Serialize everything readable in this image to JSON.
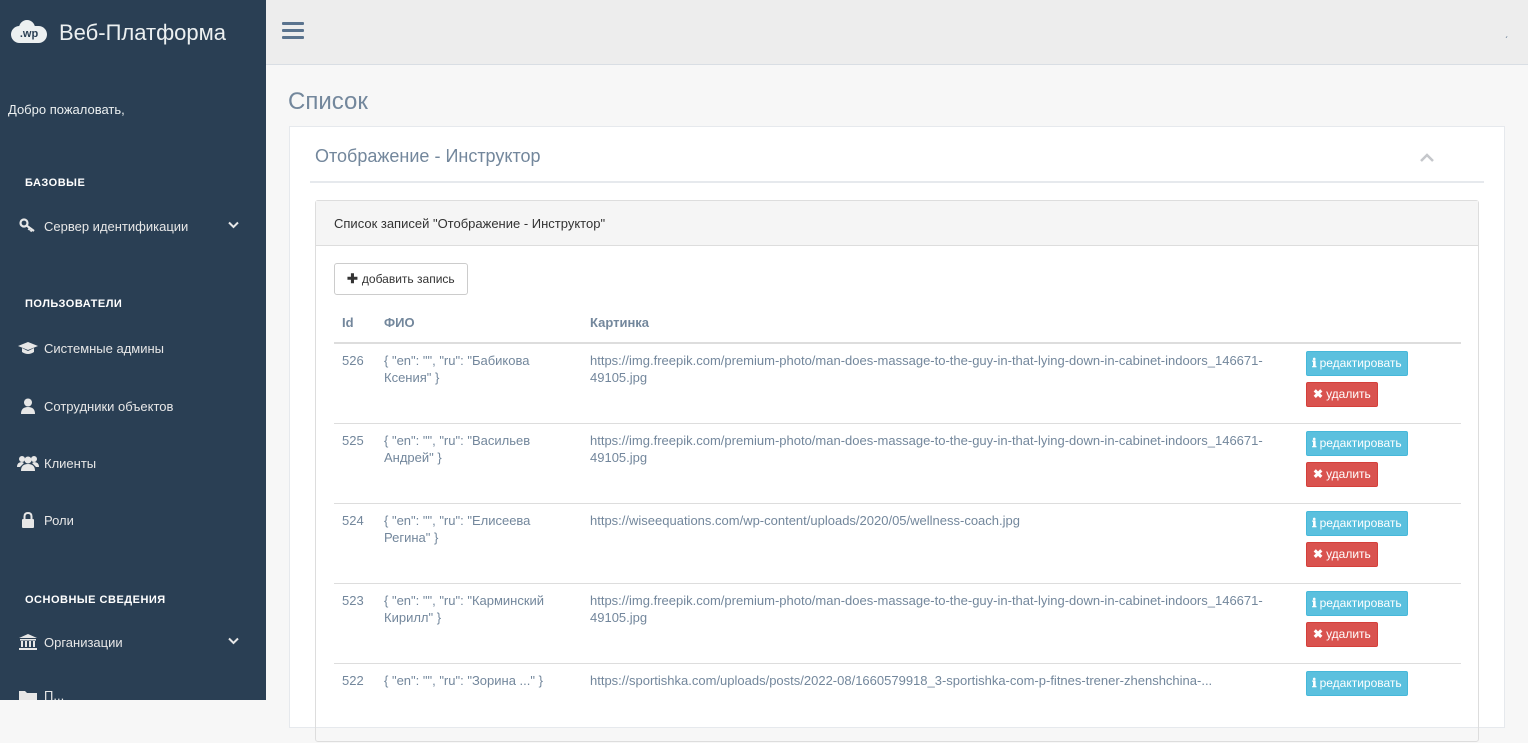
{
  "brand": {
    "logo_text": ".wp",
    "title": "Веб-Платформа"
  },
  "sidebar": {
    "welcome": "Добро пожаловать,",
    "sections": [
      {
        "title": "БАЗОВЫЕ"
      },
      {
        "title": "ПОЛЬЗОВАТЕЛИ"
      },
      {
        "title": "ОСНОВНЫЕ СВЕДЕНИЯ"
      }
    ],
    "items": [
      {
        "label": "Сервер идентификации",
        "icon": "key-icon"
      },
      {
        "label": "Системные админы",
        "icon": "graduation-cap-icon"
      },
      {
        "label": "Сотрудники объектов",
        "icon": "user-icon"
      },
      {
        "label": "Клиенты",
        "icon": "users-icon"
      },
      {
        "label": "Роли",
        "icon": "lock-icon"
      },
      {
        "label": "Организации",
        "icon": "bank-icon"
      },
      {
        "label": "П...",
        "icon": "folder-icon"
      }
    ]
  },
  "page": {
    "title": "Список"
  },
  "panel": {
    "title": "Отображение - Инструктор",
    "list_title": "Список записей \"Отображение - Инструктор\"",
    "add_label": "добавить запись",
    "columns": {
      "id": "Id",
      "fio": "ФИО",
      "picture": "Картинка"
    },
    "edit_label": "редактировать",
    "delete_label": "удалить",
    "rows": [
      {
        "id": "526",
        "fio": "{ \"en\": \"\", \"ru\": \"Бабикова Ксения\" }",
        "picture": "https://img.freepik.com/premium-photo/man-does-massage-to-the-guy-in-that-lying-down-in-cabinet-indoors_146671-49105.jpg"
      },
      {
        "id": "525",
        "fio": "{ \"en\": \"\", \"ru\": \"Васильев Андрей\" }",
        "picture": "https://img.freepik.com/premium-photo/man-does-massage-to-the-guy-in-that-lying-down-in-cabinet-indoors_146671-49105.jpg"
      },
      {
        "id": "524",
        "fio": "{ \"en\": \"\", \"ru\": \"Елисеева Регина\" }",
        "picture": "https://wiseequations.com/wp-content/uploads/2020/05/wellness-coach.jpg"
      },
      {
        "id": "523",
        "fio": "{ \"en\": \"\", \"ru\": \"Карминский Кирилл\" }",
        "picture": "https://img.freepik.com/premium-photo/man-does-massage-to-the-guy-in-that-lying-down-in-cabinet-indoors_146671-49105.jpg"
      },
      {
        "id": "522",
        "fio": "{ \"en\": \"\", \"ru\": \"Зорина ...\" }",
        "picture": "https://sportishka.com/uploads/posts/2022-08/1660579918_3-sportishka-com-p-fitnes-trener-zhenshchina-..."
      }
    ]
  }
}
